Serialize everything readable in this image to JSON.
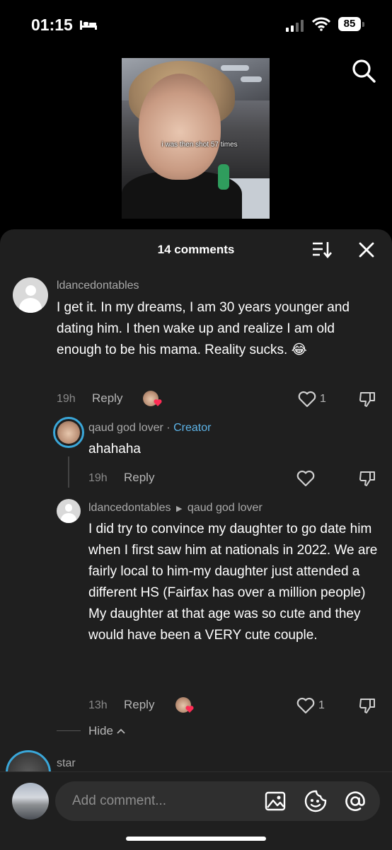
{
  "status_bar": {
    "time": "01:15",
    "battery": "85"
  },
  "video": {
    "caption": "i was then shot 57 times"
  },
  "panel": {
    "title": "14 comments"
  },
  "comments": [
    {
      "username": "ldancedontables",
      "text": "I get it. In my dreams, I am 30 years younger and dating him. I then wake up and realize I am old enough to be his mama. Reality sucks. 😂",
      "age": "19h",
      "reply_label": "Reply",
      "likes": "1"
    },
    {
      "username": "qaud god lover",
      "separator": " · ",
      "badge": "Creator",
      "text": "ahahaha",
      "age": "19h",
      "reply_label": "Reply"
    },
    {
      "username": "ldancedontables",
      "reply_to": "qaud god lover",
      "text": "I did try to convince my daughter to go date him when I first saw him at nationals in 2022. We are fairly local to him-my daughter just attended a different HS (Fairfax has over a million people) My daughter at that age was so cute and they would have been a VERY cute couple.",
      "age": "13h",
      "reply_label": "Reply",
      "likes": "1"
    },
    {
      "username": "star"
    }
  ],
  "hide_label": "Hide",
  "input": {
    "placeholder": "Add comment..."
  },
  "icons": [
    "search-icon",
    "sort-icon",
    "close-icon",
    "heart-icon",
    "dislike-icon",
    "image-icon",
    "emoji-icon",
    "mention-icon"
  ],
  "colors": {
    "creator": "#5db4e8",
    "background": "#1f1f1f"
  }
}
